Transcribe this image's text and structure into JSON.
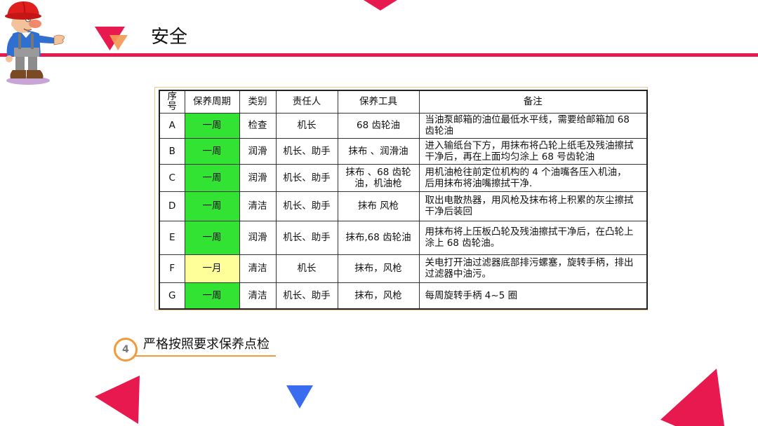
{
  "slide": {
    "title": "安全",
    "section": {
      "number": "4",
      "text": "严格按照要求保养点检"
    }
  },
  "table": {
    "headers": {
      "no": "序号",
      "cycle": "保养周期",
      "category": "类别",
      "owner": "责任人",
      "tools": "保养工具",
      "note": "备注"
    },
    "rows": [
      {
        "no": "A",
        "cycle": "一周",
        "cycle_color": "#33e333",
        "category": "检查",
        "owner": "机长",
        "tools": "68 齿轮油",
        "note": "当油泵邮箱的油位最低水平线，需要给邮箱加 68 齿轮油"
      },
      {
        "no": "B",
        "cycle": "一周",
        "cycle_color": "#33e333",
        "category": "润滑",
        "owner": "机长、助手",
        "tools": "抹布 、润滑油",
        "note": "进入输纸台下方，用抹布将凸轮上纸毛及残油擦拭干净后，再在上面均匀涂上 68 号齿轮油"
      },
      {
        "no": "C",
        "cycle": "一周",
        "cycle_color": "#33e333",
        "category": "润滑",
        "owner": "机长、助手",
        "tools": "抹布 、68 齿轮油，机油枪",
        "note": "用机油枪往前定位机构的 4 个油嘴各压入机油，后用抹布将油嘴擦拭干净."
      },
      {
        "no": "D",
        "cycle": "一周",
        "cycle_color": "#33e333",
        "category": "清洁",
        "owner": "机长、助手",
        "tools": "抹布 风枪",
        "note": "取出电散热器，用风枪及抹布将上积累的灰尘擦拭干净后装回"
      },
      {
        "no": "E",
        "cycle": "一周",
        "cycle_color": "#33e333",
        "category": "润滑",
        "owner": "机长、助手",
        "tools": "抹布,68 齿轮油",
        "note": "用抹布将上压板凸轮及残油擦拭干净后，在凸轮上涂上 68 齿轮油。"
      },
      {
        "no": "F",
        "cycle": "一月",
        "cycle_color": "#ffff99",
        "category": "清洁",
        "owner": "机长",
        "tools": "抹布，风枪",
        "note": "关电打开油过滤器底部排污螺塞，旋转手柄，排出过滤器中油污。"
      },
      {
        "no": "G",
        "cycle": "一周",
        "cycle_color": "#33e333",
        "category": "清洁",
        "owner": "机长、助手",
        "tools": "抹布，风枪",
        "note": "每周旋转手柄 4~5 圈"
      }
    ]
  },
  "colors": {
    "accent_red": "#e8194e",
    "accent_orange": "#f29a3c",
    "accent_blue": "#3a6cf0",
    "table_frame": "#f3c489"
  },
  "icons": {
    "title_marker": "triangle-marker-icon",
    "mascot": "worker-cartoon-icon"
  }
}
